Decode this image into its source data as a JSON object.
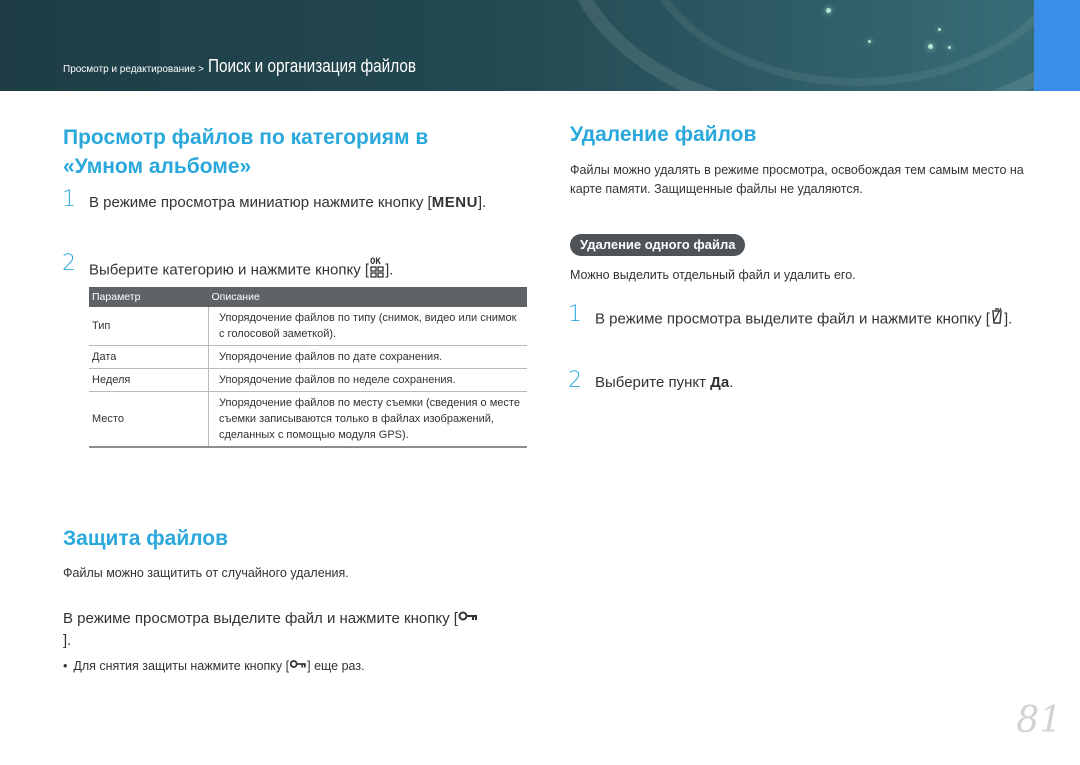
{
  "header": {
    "breadcrumb_parent": "Просмотр и редактирование >",
    "breadcrumb_current": "Поиск и организация файлов"
  },
  "section_smart_album": {
    "title": "Просмотр файлов по категориям в «Умном альбоме»",
    "step1_num": "1",
    "step1_text": "В режиме просмотра миниатюр нажмите кнопку",
    "step1_key": "MENU",
    "step2_num": "2",
    "step2_text": "Выберите категорию и нажмите кнопку",
    "table": {
      "headers": [
        "Параметр",
        "Описание"
      ],
      "rows": [
        {
          "param": "Тип",
          "desc": "Упорядочение файлов по типу (снимок, видео или снимок с голосовой заметкой)."
        },
        {
          "param": "Дата",
          "desc": "Упорядочение файлов по дате сохранения."
        },
        {
          "param": "Неделя",
          "desc": "Упорядочение файлов по неделе сохранения."
        },
        {
          "param": "Место",
          "desc": "Упорядочение файлов по месту съемки (сведения о месте съемки записываются только в файлах изображений, сделанных с помощью модуля GPS)."
        }
      ]
    }
  },
  "section_delete": {
    "title": "Удаление файлов",
    "intro": "Файлы можно удалять в режиме просмотра, освобождая тем самым место на карте памяти. Защищенные файлы не удаляются.",
    "sub_pill": "Удаление одного файла",
    "sub_intro": "Можно выделить отдельный файл и удалить его.",
    "step1_num": "1",
    "step1_text": "В режиме просмотра выделите файл и нажмите кнопку",
    "step2_num": "2",
    "step2_text": "Выберите пункт",
    "step2_bold": "Да"
  },
  "section_protect": {
    "title": "Защита файлов",
    "intro": "Файлы можно защитить от случайного удаления.",
    "step_text": "В режиме просмотра выделите файл и нажмите кнопку",
    "note_prefix": "Для снятия защиты нажмите кнопку",
    "note_suffix": "еще раз."
  },
  "page_number": "81",
  "colors": {
    "accent": "#2aa8dc",
    "header_bg": "#234851",
    "tab_blue": "#3a8de8"
  },
  "icons": [
    "ok-grid-icon",
    "trash-icon",
    "key-protect-icon"
  ]
}
